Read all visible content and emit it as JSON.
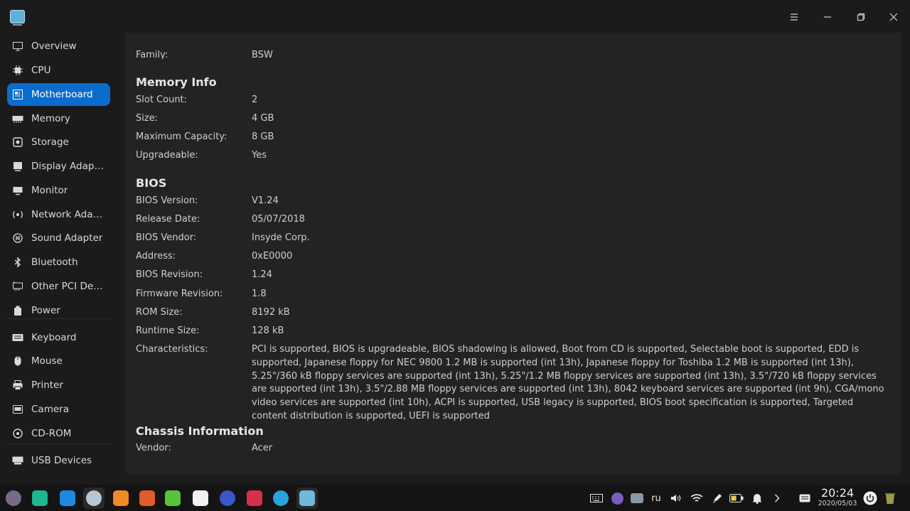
{
  "window": {
    "menu_icon": "hamburger-menu-icon",
    "minimize_icon": "minimize-icon",
    "maximize_icon": "restore-icon",
    "close_icon": "close-icon"
  },
  "sidebar": {
    "items": [
      {
        "label": "Overview",
        "icon": "overview-icon"
      },
      {
        "label": "CPU",
        "icon": "cpu-icon"
      },
      {
        "label": "Motherboard",
        "icon": "motherboard-icon",
        "active": true
      },
      {
        "label": "Memory",
        "icon": "memory-icon"
      },
      {
        "label": "Storage",
        "icon": "storage-icon"
      },
      {
        "label": "Display Adapter",
        "icon": "display-adapter-icon"
      },
      {
        "label": "Monitor",
        "icon": "monitor-icon"
      },
      {
        "label": "Network Adapt...",
        "icon": "network-adapter-icon"
      },
      {
        "label": "Sound Adapter",
        "icon": "sound-adapter-icon"
      },
      {
        "label": "Bluetooth",
        "icon": "bluetooth-icon"
      },
      {
        "label": "Other PCI Devi...",
        "icon": "pci-device-icon"
      },
      {
        "label": "Power",
        "icon": "power-icon"
      },
      {
        "label": "Keyboard",
        "icon": "keyboard-icon"
      },
      {
        "label": "Mouse",
        "icon": "mouse-icon"
      },
      {
        "label": "Printer",
        "icon": "printer-icon"
      },
      {
        "label": "Camera",
        "icon": "camera-icon"
      },
      {
        "label": "CD-ROM",
        "icon": "cdrom-icon"
      },
      {
        "label": "USB Devices",
        "icon": "usb-icon"
      }
    ]
  },
  "content": {
    "top_row": {
      "label": "Family:",
      "value": "BSW"
    },
    "memory": {
      "title": "Memory Info",
      "rows": [
        {
          "label": "Slot Count:",
          "value": "2"
        },
        {
          "label": "Size:",
          "value": "4 GB"
        },
        {
          "label": "Maximum Capacity:",
          "value": "8 GB"
        },
        {
          "label": "Upgradeable:",
          "value": "Yes"
        }
      ]
    },
    "bios": {
      "title": "BIOS",
      "rows": [
        {
          "label": "BIOS Version:",
          "value": "V1.24"
        },
        {
          "label": "Release Date:",
          "value": "05/07/2018"
        },
        {
          "label": "BIOS Vendor:",
          "value": "Insyde Corp."
        },
        {
          "label": "Address:",
          "value": "0xE0000"
        },
        {
          "label": "BIOS Revision:",
          "value": "1.24"
        },
        {
          "label": "Firmware Revision:",
          "value": "1.8"
        },
        {
          "label": "ROM Size:",
          "value": "8192 kB"
        },
        {
          "label": "Runtime Size:",
          "value": "128 kB"
        }
      ],
      "characteristics_label": "Characteristics:",
      "characteristics_value": "PCI is supported, BIOS is upgradeable, BIOS shadowing is allowed, Boot from CD is supported, Selectable boot is supported, EDD is supported, Japanese floppy for NEC 9800 1.2 MB is supported (int 13h), Japanese floppy for Toshiba 1.2 MB is supported (int 13h), 5.25\"/360 kB floppy services are supported (int 13h), 5.25\"/1.2 MB floppy services are supported (int 13h), 3.5\"/720 kB floppy services are supported (int 13h), 3.5\"/2.88 MB floppy services are supported (int 13h), 8042 keyboard services are supported (int 9h), CGA/mono video services are supported (int 10h), ACPI is supported, USB legacy is supported, BIOS boot specification is supported, Targeted content distribution is supported, UEFI is supported"
    },
    "chassis": {
      "title": "Chassis Information",
      "rows": [
        {
          "label": "Vendor:",
          "value": "Acer"
        }
      ]
    }
  },
  "dock": {
    "apps": [
      {
        "name": "launcher-icon",
        "color": "#7a6a8a"
      },
      {
        "name": "multitasking-icon",
        "color": "#1fb58f"
      },
      {
        "name": "app-store-icon",
        "color": "#1e88e5"
      },
      {
        "name": "browser-icon",
        "color": "#b9c7d3"
      },
      {
        "name": "archive-manager-icon",
        "color": "#f08a24"
      },
      {
        "name": "image-viewer-icon",
        "color": "#e25b2b"
      },
      {
        "name": "music-icon",
        "color": "#58c43a"
      },
      {
        "name": "calendar-icon",
        "color": "#f2f2f2"
      },
      {
        "name": "settings-icon",
        "color": "#3a57c8"
      },
      {
        "name": "terminal-icon",
        "color": "#d8304a"
      },
      {
        "name": "telegram-icon",
        "color": "#2aa3dd"
      },
      {
        "name": "device-manager-icon",
        "color": "#6fb9dc"
      }
    ],
    "tray": {
      "keyboard_icon": "keyboard-layout-icon",
      "viber_icon": "viber-icon",
      "disk_icon": "disk-icon",
      "language": "ru",
      "volume_icon": "volume-icon",
      "wifi_icon": "wifi-icon",
      "pen_icon": "pen-icon",
      "battery_icon": "battery-icon",
      "notification_icon": "notification-bell-icon",
      "expand_icon": "chevron-right-icon",
      "onscreen_keyboard_icon": "onscreen-keyboard-icon",
      "time": "20:24",
      "date": "2020/05/03",
      "power_icon": "power-button-icon",
      "trash_icon": "trash-icon"
    }
  }
}
